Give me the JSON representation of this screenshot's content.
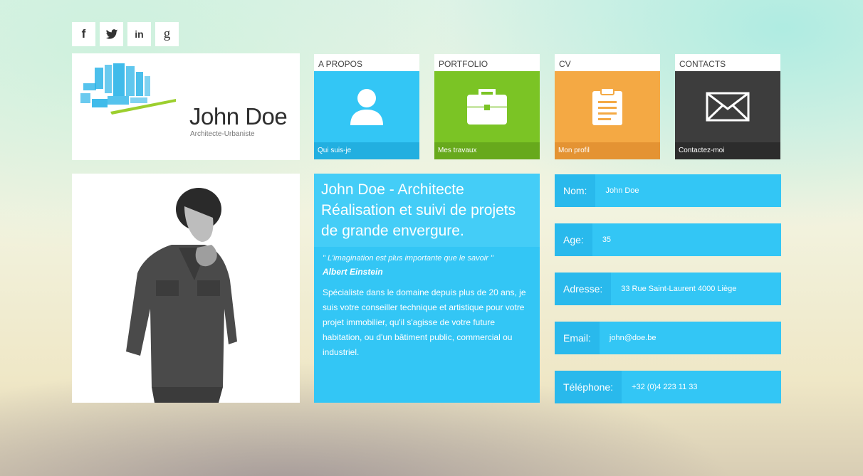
{
  "social": [
    {
      "label": "f",
      "icon": "facebook-icon"
    },
    {
      "label": "",
      "icon": "twitter-icon"
    },
    {
      "label": "in",
      "icon": "linkedin-icon"
    },
    {
      "label": "g",
      "icon": "google-icon"
    }
  ],
  "profile": {
    "name": "John Doe",
    "subtitle": "Architecte-Urbaniste"
  },
  "tiles": [
    {
      "title": "A PROPOS",
      "footer": "Qui suis-je",
      "icon": "user-icon",
      "color": "#33c6f5"
    },
    {
      "title": "PORTFOLIO",
      "footer": "Mes travaux",
      "icon": "briefcase-icon",
      "color": "#7bc425"
    },
    {
      "title": "CV",
      "footer": "Mon profil",
      "icon": "clipboard-icon",
      "color": "#f4a944"
    },
    {
      "title": "CONTACTS",
      "footer": "Contactez-moi",
      "icon": "envelope-icon",
      "color": "#3d3d3d"
    }
  ],
  "bio": {
    "headline": "John Doe - Architecte Réalisation et suivi de projets de grande envergure.",
    "quote": "\" L'imagination est plus importante que le savoir \"",
    "author": "Albert Einstein",
    "text": "Spécialiste dans le domaine depuis plus de 20 ans, je suis votre conseiller technique et artistique pour votre projet immobilier, qu'il s'agisse de votre future habitation, ou d'un bâtiment public, commercial ou industriel."
  },
  "info": [
    {
      "label": "Nom:",
      "value": "John Doe"
    },
    {
      "label": "Age:",
      "value": "35"
    },
    {
      "label": "Adresse:",
      "value": "33 Rue Saint-Laurent 4000 Liège"
    },
    {
      "label": "Email:",
      "value": "john@doe.be"
    },
    {
      "label": "Téléphone:",
      "value": "+32 (0)4 223 11 33"
    }
  ]
}
